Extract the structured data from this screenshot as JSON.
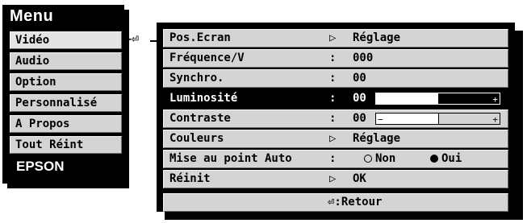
{
  "menu": {
    "title": "Menu",
    "items": [
      {
        "label": "Vidéo"
      },
      {
        "label": "Audio"
      },
      {
        "label": "Option"
      },
      {
        "label": "Personnalisé"
      },
      {
        "label": "A Propos"
      },
      {
        "label": "Tout Réint"
      }
    ],
    "brand": "EPSON",
    "enter_glyph": "←⏎"
  },
  "submenu": {
    "rows": [
      {
        "label": "Pos.Ecran",
        "sep": "▷",
        "value": "Réglage"
      },
      {
        "label": "Fréquence/V",
        "sep": ":",
        "value": "000"
      },
      {
        "label": "Synchro.",
        "sep": ":",
        "value": "00"
      },
      {
        "label": "Luminosité",
        "sep": ":",
        "value": "00",
        "slider_level": 0.5
      },
      {
        "label": "Contraste",
        "sep": ":",
        "value": "00",
        "slider_level": 0.5
      },
      {
        "label": "Couleurs",
        "sep": "▷",
        "value": "Réglage"
      },
      {
        "label": "Mise au point Auto",
        "sep": ":",
        "option_off": "Non",
        "option_on": "Oui",
        "selected_option": "Oui"
      },
      {
        "label": "Réinit",
        "sep": "▷",
        "value": "OK"
      }
    ],
    "footer": "⏎:Retour",
    "slider_minus": "−",
    "slider_plus": "+"
  }
}
